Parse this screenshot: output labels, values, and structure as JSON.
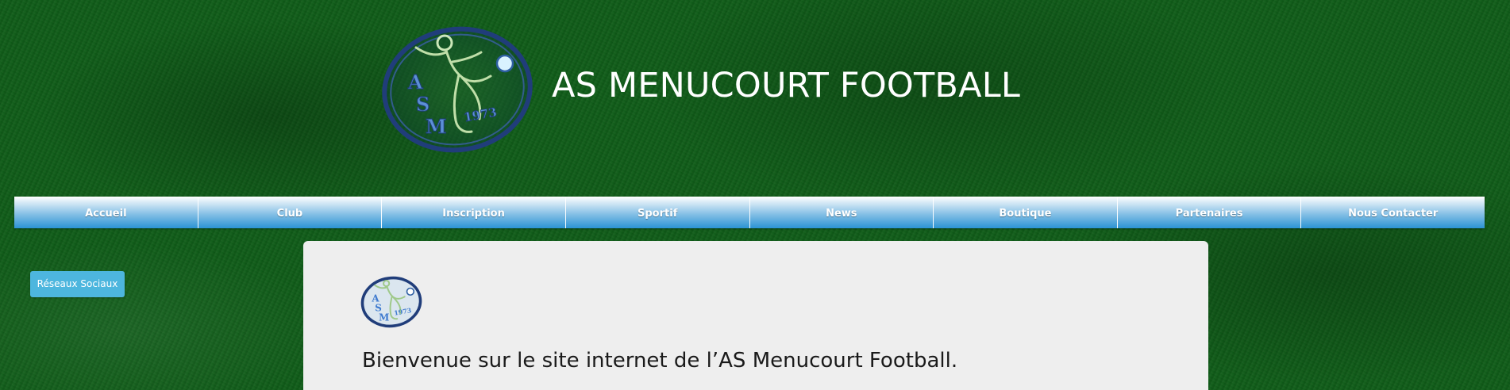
{
  "header": {
    "logo_name": "asm-crest-logo",
    "logo_text": "ASM 1973",
    "title": "AS MENUCOURT FOOTBALL"
  },
  "nav": {
    "items": [
      {
        "label": "Accueil"
      },
      {
        "label": "Club"
      },
      {
        "label": "Inscription"
      },
      {
        "label": "Sportif"
      },
      {
        "label": "News"
      },
      {
        "label": "Boutique"
      },
      {
        "label": "Partenaires"
      },
      {
        "label": "Nous Contacter"
      }
    ]
  },
  "sidebar": {
    "social_button_label": "Réseaux Sociaux"
  },
  "content": {
    "logo_text": "ASM 1973",
    "welcome_text": "Bienvenue sur le site internet de l’AS Menucourt Football."
  },
  "colors": {
    "background": "#0d5a16",
    "nav_gradient_top": "#ffffff",
    "nav_gradient_bottom": "#2b93d4",
    "social_button": "#4db6de",
    "panel": "#eeeeee"
  }
}
